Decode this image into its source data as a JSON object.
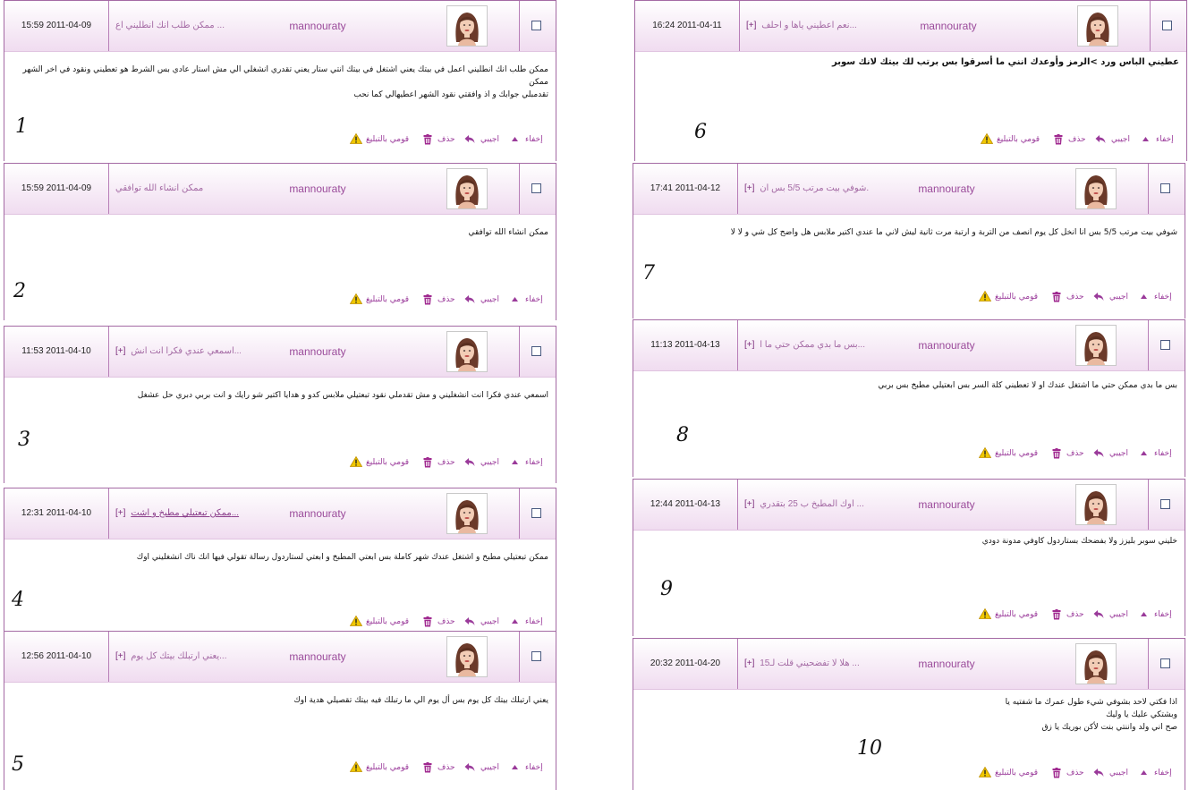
{
  "cards": [
    {
      "number": "1",
      "date": "15:59 2011-04-09",
      "expand": "",
      "subject": "ممكن طلب انك انطليني اع...",
      "sender": "mannouraty",
      "body": "ممكن طلب انك انطليني اعمل في بيتك يعني اشتغل في بيتك انتي ستار يعني تقدري انشغلي الي مش استار عادي بس الشرط هو تعطيني ونقود في اخر الشهر ممكن\nتقدمبلي جوابك و اذ وافقتي نقود الشهر اعطيهالي كما نحب",
      "bold": false
    },
    {
      "number": "2",
      "date": "15:59 2011-04-09",
      "expand": "",
      "subject": "ممكن انشاء الله توافقي",
      "sender": "mannouraty",
      "body": "ممكن انشاء الله توافقي",
      "bold": false
    },
    {
      "number": "3",
      "date": "11:53 2011-04-10",
      "expand": "[+]",
      "subject": "اسمعي عندي فكرا انت انش...",
      "sender": "mannouraty",
      "body": "اسمعي عندي فكرا انت انشغليني و مش تقدملي نقود تبعتيلي ملابس كدو و هدايا اكتير شو رايك و انت بربي دبري حل عشغل",
      "bold": false
    },
    {
      "number": "4",
      "date": "12:31 2011-04-10",
      "expand": "[+]",
      "subject": "ممكن تبعتيلي مطبخ و اشت...",
      "sender": "mannouraty",
      "body": "ممكن تبعتيلي مطبخ و اشتغل عندك شهر كاملة بس ابعتي المطبخ و ابعتي لستاردول    رسالة تقولي فيها انك ناك انشغليني اوك",
      "bold": false
    },
    {
      "number": "5",
      "date": "12:56 2011-04-10",
      "expand": "[+]",
      "subject": "يعني ارتبلك بيتك كل يوم...",
      "sender": "mannouraty",
      "body": "يعني ارتبلك بيتك كل يوم بس أل يوم الي ما رتبلك فيه بيتك تقصيلي هدية اوك",
      "bold": false
    },
    {
      "number": "6",
      "date": "16:24 2011-04-11",
      "expand": "[+]",
      "subject": "نعم اعطيني ياها و احلف...",
      "sender": "mannouraty",
      "body": "عطيني الباس ورد >الرمز وأوعدك انني ما أسرقوا بس برتب لك بيتك لانك سوبر",
      "bold": true
    },
    {
      "number": "7",
      "date": "17:41 2011-04-12",
      "expand": "[+]",
      "subject": "شوفي بيت مرتب 5/5 بس ان...",
      "sender": "mannouraty",
      "body": "شوفي بيت مرتب 5/5 بس انا انخل كل يوم انصف من التربة و ارتبة مرت ثانية ليش لاني ما عندي اكتير ملابس هل واضح كل شي و لا لا",
      "bold": false
    },
    {
      "number": "8",
      "date": "11:13 2011-04-13",
      "expand": "[+]",
      "subject": "بس ما بدي ممكن حتي ما ا...",
      "sender": "mannouraty",
      "body": "بس ما بدي ممكن حتي ما اشتغل عندك او لا تعطيني كلة السر بس ابعتيلي مطبخ بس بربي",
      "bold": false
    },
    {
      "number": "9",
      "date": "12:44 2011-04-13",
      "expand": "[+]",
      "subject": "اوك المطبخ ب 25 بتقدري ...",
      "sender": "mannouraty",
      "body": "خليني سوبر بليزز ولا بفضحك بستاردول كاوفي مدونة دودي",
      "bold": false
    },
    {
      "number": "10",
      "date": "20:32 2011-04-20",
      "expand": "[+]",
      "subject": "هلا لا تفضحيني قلت لـ15 ...",
      "sender": "mannouraty",
      "body": "اذا فكتي لاحد بشوفي شيء طول عمرك ما شفتيه يا\nوبشتكي عليك  يا وليك\nصح اني ولد واننتي بنت لأكن بوريك يا زق",
      "bold": false
    }
  ],
  "actions": {
    "hide": "إخفاء",
    "reply": "اجيبي",
    "delete": "حذف",
    "report": "قومي بالتبليغ"
  },
  "colors": {
    "accent": "#9a3a9a",
    "header_gradient": "#f0dcf0",
    "border": "#a46aa4",
    "warning": "#f0c800"
  },
  "icons": {
    "hide": "caret-up-icon",
    "reply": "reply-arrow-icon",
    "delete": "trash-icon",
    "report": "warning-icon",
    "avatar": "user-avatar-icon"
  }
}
